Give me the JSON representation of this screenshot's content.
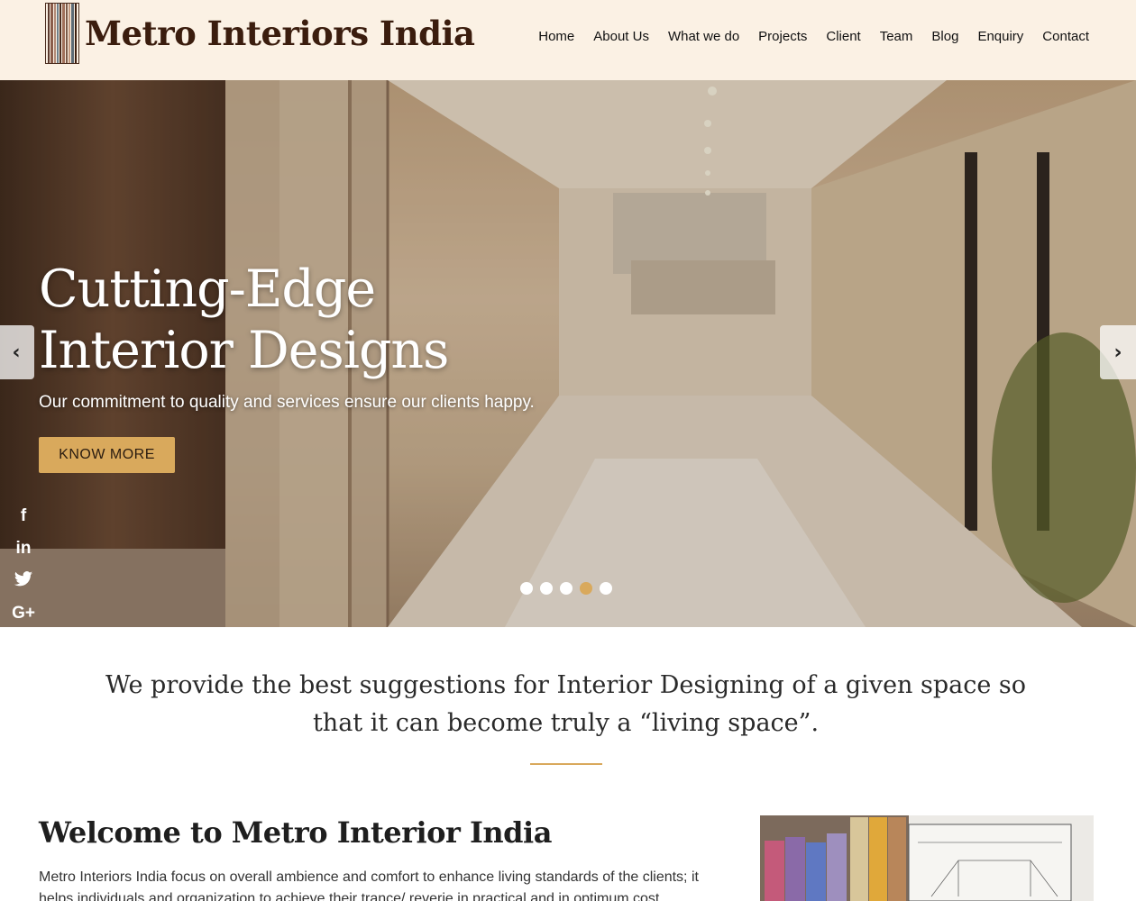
{
  "brand": {
    "name": "Metro Interiors India",
    "stripe_colors": [
      "#5b3a2e",
      "#8a5c4a",
      "#b38a76",
      "#6e7f8a",
      "#4a2c1e",
      "#a0705a",
      "#7a5a48",
      "#c49a80",
      "#5d6b75",
      "#3b1d0e"
    ]
  },
  "nav": {
    "items": [
      {
        "label": "Home"
      },
      {
        "label": "About Us"
      },
      {
        "label": "What we do"
      },
      {
        "label": "Projects"
      },
      {
        "label": "Client"
      },
      {
        "label": "Team"
      },
      {
        "label": "Blog"
      },
      {
        "label": "Enquiry"
      },
      {
        "label": "Contact"
      }
    ]
  },
  "hero": {
    "title_line1": "Cutting-Edge",
    "title_line2": "Interior Designs",
    "subtitle": "Our commitment to quality and services ensure our clients happy.",
    "button_label": "KNOW MORE",
    "prev_icon": "chevron-left-icon",
    "next_icon": "chevron-right-icon",
    "slide_count": 5,
    "active_slide": 4
  },
  "social": [
    {
      "name": "facebook-icon",
      "glyph": "f"
    },
    {
      "name": "linkedin-icon",
      "glyph": "in"
    },
    {
      "name": "twitter-icon",
      "glyph": "🐦"
    },
    {
      "name": "google-plus-icon",
      "glyph": "G+"
    }
  ],
  "tagline": "We provide the best suggestions for Interior Designing of a given space so that it can become truly a “living space”.",
  "welcome": {
    "title": "Welcome to Metro Interior India",
    "text": "Metro Interiors India focus on overall ambience and comfort to enhance living standards of the clients; it helps individuals and organization to achieve their trance/ reverie in practical and in optimum cost."
  },
  "colors": {
    "header_bg": "#fbf1e4",
    "accent": "#d9a95c",
    "brand_text": "#3b1d0e"
  }
}
